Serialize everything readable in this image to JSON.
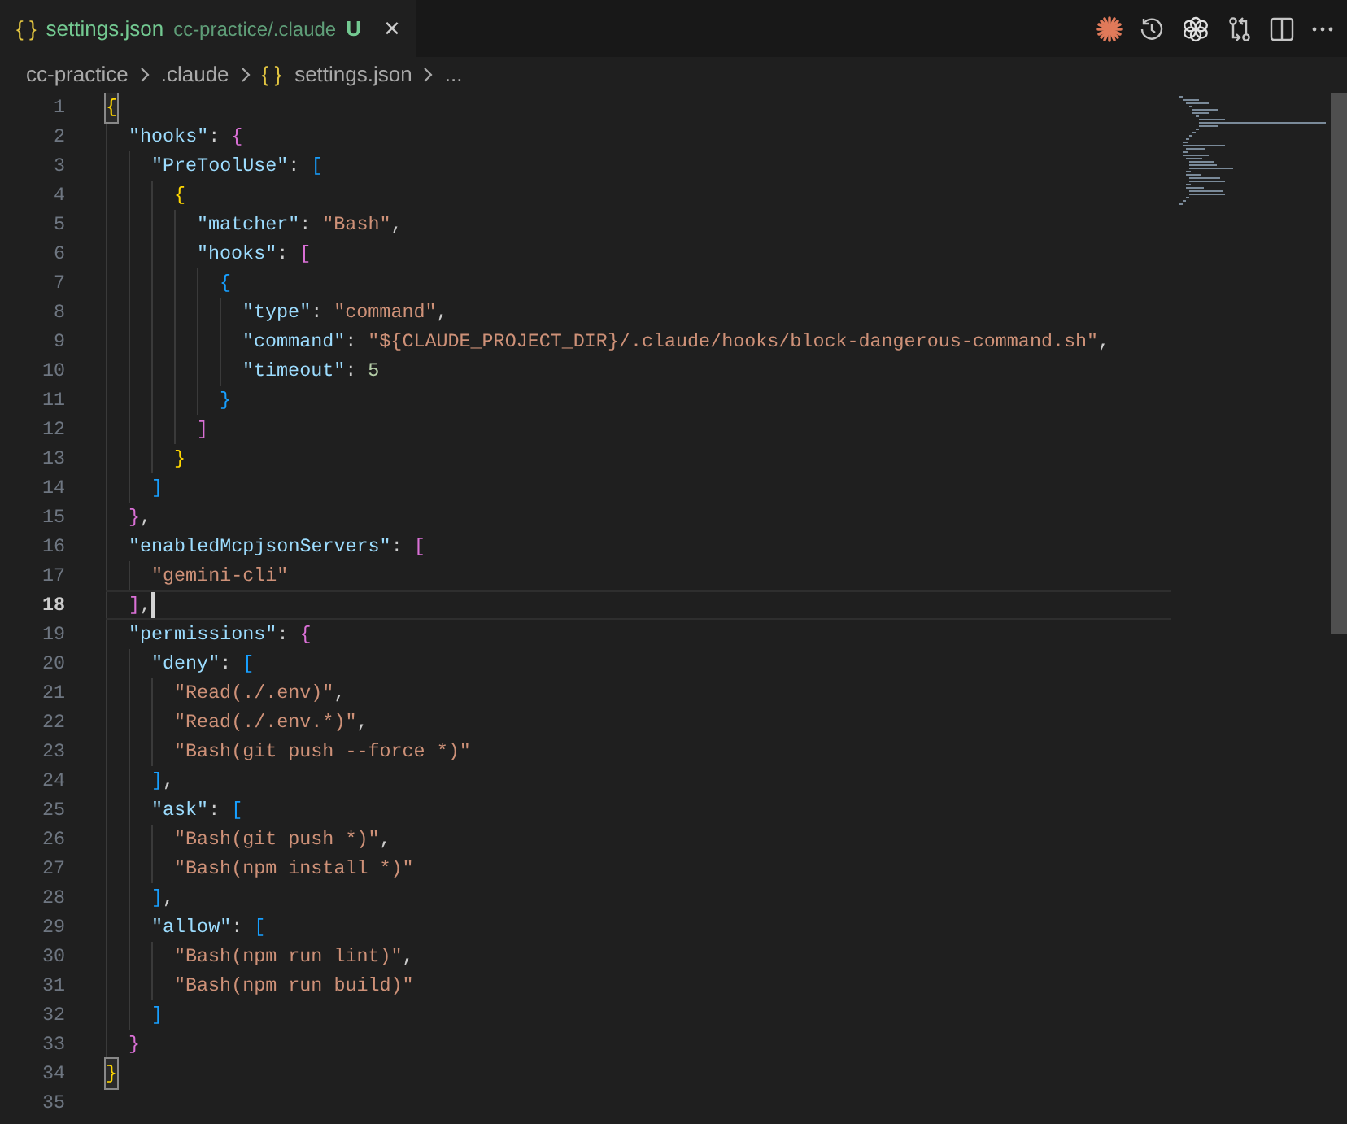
{
  "tab": {
    "icon": "{ }",
    "title": "settings.json",
    "path": "cc-practice/.claude",
    "status": "U",
    "close": "×",
    "selected": true
  },
  "breadcrumbs": [
    {
      "kind": "folder",
      "text": "cc-practice"
    },
    {
      "kind": "folder",
      "text": ".claude"
    },
    {
      "kind": "file",
      "icon": "{ }",
      "text": "settings.json"
    },
    {
      "kind": "more",
      "text": "..."
    }
  ],
  "lines": [
    {
      "n": "1",
      "current": false,
      "tokens": [
        {
          "kind": "bracket_match",
          "text": "{",
          "color": "#ffd700"
        }
      ],
      "children": [
        {
          "n": "2",
          "current": false,
          "tokens": [
            {
              "kind": "key",
              "text": "\"hooks\""
            },
            {
              "kind": "punct",
              "text": ": "
            },
            {
              "kind": "bracket",
              "text": "{",
              "color": "#da70d6"
            }
          ],
          "children": [
            {
              "n": "3",
              "current": false,
              "tokens": [
                {
                  "kind": "key",
                  "text": "\"PreToolUse\""
                },
                {
                  "kind": "punct",
                  "text": ": "
                },
                {
                  "kind": "bracket",
                  "text": "[",
                  "color": "#179fff"
                }
              ],
              "children": [
                {
                  "n": "4",
                  "current": false,
                  "tokens": [
                    {
                      "kind": "bracket",
                      "text": "{",
                      "color": "#ffd700"
                    }
                  ],
                  "children": [
                    {
                      "n": "5",
                      "current": false,
                      "tokens": [
                        {
                          "kind": "key",
                          "text": "\"matcher\""
                        },
                        {
                          "kind": "punct",
                          "text": ": "
                        },
                        {
                          "kind": "string",
                          "text": "\"Bash\""
                        },
                        {
                          "kind": "punct",
                          "text": ","
                        }
                      ]
                    },
                    {
                      "n": "6",
                      "current": false,
                      "tokens": [
                        {
                          "kind": "key",
                          "text": "\"hooks\""
                        },
                        {
                          "kind": "punct",
                          "text": ": "
                        },
                        {
                          "kind": "bracket",
                          "text": "[",
                          "color": "#da70d6"
                        }
                      ],
                      "children": [
                        {
                          "n": "7",
                          "current": false,
                          "tokens": [
                            {
                              "kind": "bracket",
                              "text": "{",
                              "color": "#179fff"
                            }
                          ],
                          "children": [
                            {
                              "n": "8",
                              "current": false,
                              "tokens": [
                                {
                                  "kind": "key",
                                  "text": "\"type\""
                                },
                                {
                                  "kind": "punct",
                                  "text": ": "
                                },
                                {
                                  "kind": "string",
                                  "text": "\"command\""
                                },
                                {
                                  "kind": "punct",
                                  "text": ","
                                }
                              ]
                            },
                            {
                              "n": "9",
                              "current": false,
                              "tokens": [
                                {
                                  "kind": "key",
                                  "text": "\"command\""
                                },
                                {
                                  "kind": "punct",
                                  "text": ": "
                                },
                                {
                                  "kind": "string",
                                  "text": "\"${CLAUDE_PROJECT_DIR}/.claude/hooks/block-dangerous-command.sh\""
                                },
                                {
                                  "kind": "punct",
                                  "text": ","
                                }
                              ]
                            },
                            {
                              "n": "10",
                              "current": false,
                              "tokens": [
                                {
                                  "kind": "key",
                                  "text": "\"timeout\""
                                },
                                {
                                  "kind": "punct",
                                  "text": ": "
                                },
                                {
                                  "kind": "number",
                                  "text": "5"
                                }
                              ]
                            }
                          ]
                        },
                        {
                          "n": "11",
                          "current": false,
                          "tokens": [
                            {
                              "kind": "bracket",
                              "text": "}",
                              "color": "#179fff"
                            }
                          ]
                        }
                      ]
                    },
                    {
                      "n": "12",
                      "current": false,
                      "tokens": [
                        {
                          "kind": "bracket",
                          "text": "]",
                          "color": "#da70d6"
                        }
                      ]
                    }
                  ]
                },
                {
                  "n": "13",
                  "current": false,
                  "tokens": [
                    {
                      "kind": "bracket",
                      "text": "}",
                      "color": "#ffd700"
                    }
                  ]
                }
              ]
            },
            {
              "n": "14",
              "current": false,
              "tokens": [
                {
                  "kind": "bracket",
                  "text": "]",
                  "color": "#179fff"
                }
              ]
            }
          ]
        },
        {
          "n": "15",
          "current": false,
          "tokens": [
            {
              "kind": "bracket",
              "text": "}",
              "color": "#da70d6"
            },
            {
              "kind": "punct",
              "text": ","
            }
          ]
        },
        {
          "n": "16",
          "current": false,
          "tokens": [
            {
              "kind": "key",
              "text": "\"enabledMcpjsonServers\""
            },
            {
              "kind": "punct",
              "text": ": "
            },
            {
              "kind": "bracket",
              "text": "[",
              "color": "#da70d6"
            }
          ],
          "children": [
            {
              "n": "17",
              "current": false,
              "tokens": [
                {
                  "kind": "string",
                  "text": "\"gemini-cli\""
                }
              ]
            }
          ]
        },
        {
          "n": "18",
          "current": true,
          "tokens": [
            {
              "kind": "bracket",
              "text": "]",
              "color": "#da70d6"
            },
            {
              "kind": "punct",
              "text": ","
            }
          ]
        },
        {
          "n": "19",
          "current": false,
          "tokens": [
            {
              "kind": "key",
              "text": "\"permissions\""
            },
            {
              "kind": "punct",
              "text": ": "
            },
            {
              "kind": "bracket",
              "text": "{",
              "color": "#da70d6"
            }
          ],
          "children": [
            {
              "n": "20",
              "current": false,
              "tokens": [
                {
                  "kind": "key",
                  "text": "\"deny\""
                },
                {
                  "kind": "punct",
                  "text": ": "
                },
                {
                  "kind": "bracket",
                  "text": "[",
                  "color": "#179fff"
                }
              ],
              "children": [
                {
                  "n": "21",
                  "current": false,
                  "tokens": [
                    {
                      "kind": "string",
                      "text": "\"Read(./.env)\""
                    },
                    {
                      "kind": "punct",
                      "text": ","
                    }
                  ]
                },
                {
                  "n": "22",
                  "current": false,
                  "tokens": [
                    {
                      "kind": "string",
                      "text": "\"Read(./.env.*)\""
                    },
                    {
                      "kind": "punct",
                      "text": ","
                    }
                  ]
                },
                {
                  "n": "23",
                  "current": false,
                  "tokens": [
                    {
                      "kind": "string",
                      "text": "\"Bash(git push --force *)\""
                    }
                  ]
                }
              ]
            },
            {
              "n": "24",
              "current": false,
              "tokens": [
                {
                  "kind": "bracket",
                  "text": "]",
                  "color": "#179fff"
                },
                {
                  "kind": "punct",
                  "text": ","
                }
              ]
            },
            {
              "n": "25",
              "current": false,
              "tokens": [
                {
                  "kind": "key",
                  "text": "\"ask\""
                },
                {
                  "kind": "punct",
                  "text": ": "
                },
                {
                  "kind": "bracket",
                  "text": "[",
                  "color": "#179fff"
                }
              ],
              "children": [
                {
                  "n": "26",
                  "current": false,
                  "tokens": [
                    {
                      "kind": "string",
                      "text": "\"Bash(git push *)\""
                    },
                    {
                      "kind": "punct",
                      "text": ","
                    }
                  ]
                },
                {
                  "n": "27",
                  "current": false,
                  "tokens": [
                    {
                      "kind": "string",
                      "text": "\"Bash(npm install *)\""
                    }
                  ]
                }
              ]
            },
            {
              "n": "28",
              "current": false,
              "tokens": [
                {
                  "kind": "bracket",
                  "text": "]",
                  "color": "#179fff"
                },
                {
                  "kind": "punct",
                  "text": ","
                }
              ]
            },
            {
              "n": "29",
              "current": false,
              "tokens": [
                {
                  "kind": "key",
                  "text": "\"allow\""
                },
                {
                  "kind": "punct",
                  "text": ": "
                },
                {
                  "kind": "bracket",
                  "text": "[",
                  "color": "#179fff"
                }
              ],
              "children": [
                {
                  "n": "30",
                  "current": false,
                  "tokens": [
                    {
                      "kind": "string",
                      "text": "\"Bash(npm run lint)\""
                    },
                    {
                      "kind": "punct",
                      "text": ","
                    }
                  ]
                },
                {
                  "n": "31",
                  "current": false,
                  "tokens": [
                    {
                      "kind": "string",
                      "text": "\"Bash(npm run build)\""
                    }
                  ]
                }
              ]
            },
            {
              "n": "32",
              "current": false,
              "tokens": [
                {
                  "kind": "bracket",
                  "text": "]",
                  "color": "#179fff"
                }
              ]
            }
          ]
        },
        {
          "n": "33",
          "current": false,
          "tokens": [
            {
              "kind": "bracket",
              "text": "}",
              "color": "#da70d6"
            }
          ]
        }
      ]
    },
    {
      "n": "34",
      "current": false,
      "tokens": [
        {
          "kind": "bracket_match",
          "text": "}",
          "color": "#ffd700"
        }
      ]
    },
    {
      "n": "35",
      "current": false
    }
  ]
}
